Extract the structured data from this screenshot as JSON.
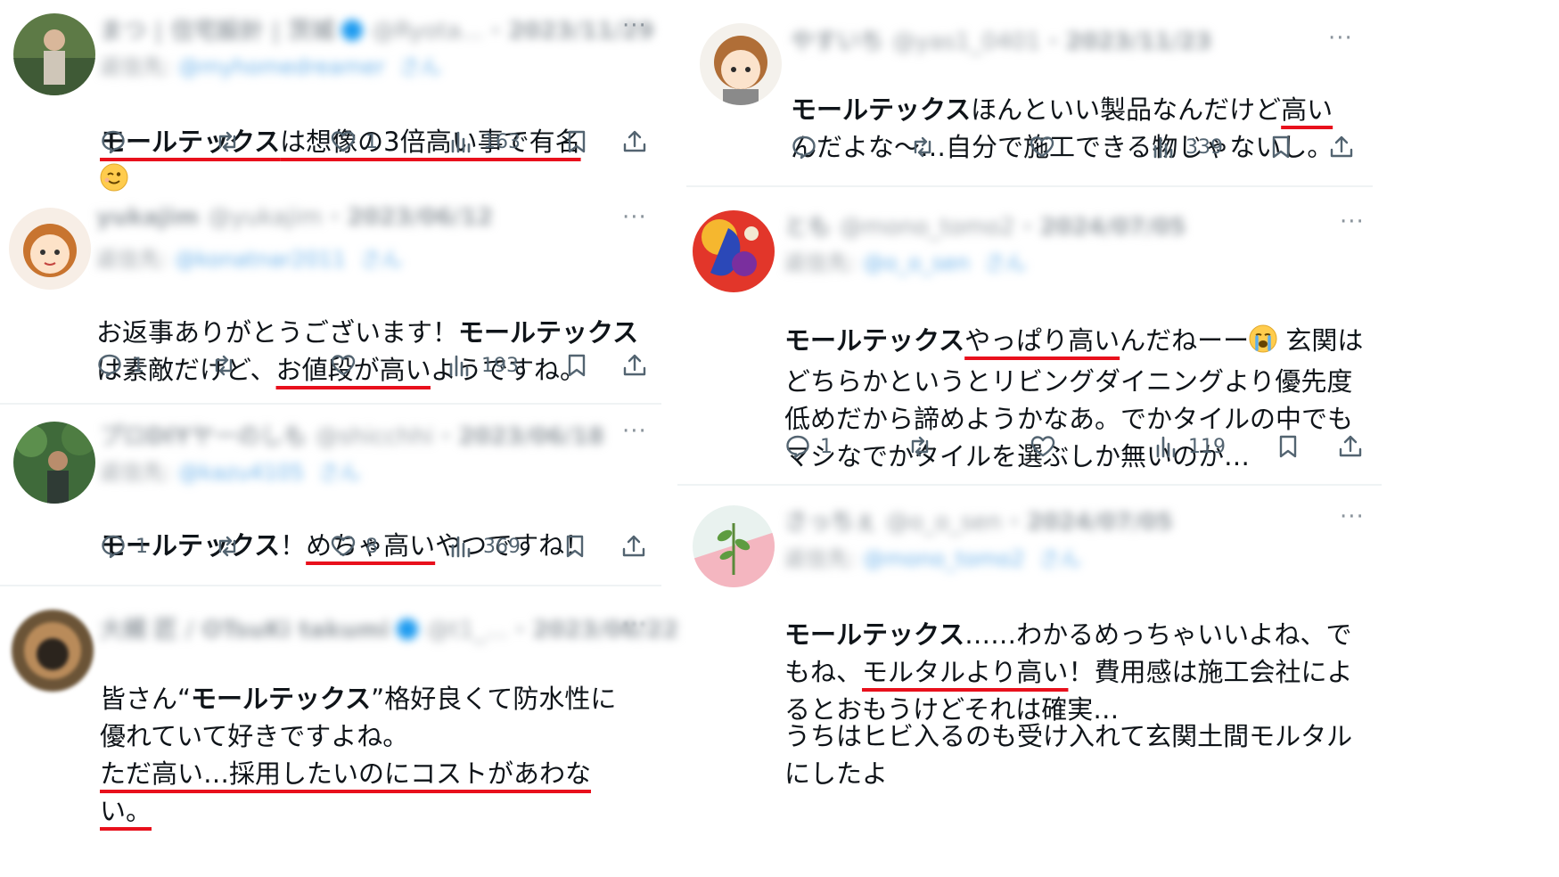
{
  "brand_word": "モールテックス",
  "colors": {
    "underline": "#e8101c",
    "text": "#0f1419",
    "meta": "#536471",
    "verified": "#1d9bf0"
  },
  "tweets": [
    {
      "author": "まつ | 住宅設計 | 茨城",
      "handle": "@Ryota...",
      "date": "2023/11/29",
      "reply_to": "@myhomedreamer",
      "body": {
        "brand": "モールテックス",
        "underlined_after_brand": "は想像の3倍高い事で有名",
        "emoji": "wink-emoji"
      },
      "stats": {
        "replies": "",
        "reposts": "",
        "likes": "1",
        "views": "163"
      }
    },
    {
      "author": "yukajim",
      "handle": "@yukajim",
      "date": "2023/06/12",
      "reply_to": "@konatnar2011",
      "body": {
        "prefix": "お返事ありがとうございます！",
        "brand": "モールテックス",
        "text_after_brand": "は素敵だけど、",
        "underlined": "お値段が高い",
        "suffix": "ようですね。"
      },
      "stats": {
        "replies": "1",
        "reposts": "",
        "likes": "",
        "views": "193"
      }
    },
    {
      "author": "プロDIYヤーのしも",
      "handle": "@shicchhi",
      "date": "2023/06/18",
      "reply_to": "@kazu4105",
      "body": {
        "brand": "モールテックス",
        "text_after_brand": "！",
        "underlined": "めちゃ高い",
        "suffix": "やつですね！"
      },
      "stats": {
        "replies": "1",
        "reposts": "",
        "likes": "8",
        "views": "369"
      }
    },
    {
      "author": "大槻 匠 / OTsuKi takumi",
      "handle": "@t1_...",
      "date": "2023/06/22",
      "body": {
        "prefix": "皆さん“",
        "brand": "モールテックス",
        "text_after_brand": "”格好良くて防水性に優れていて好きですよね。",
        "underlined": "ただ高い…採用したいのにコストがあわない。"
      }
    },
    {
      "author": "やすいち",
      "handle": "@yas1_0401",
      "date": "2023/11/23",
      "body": {
        "brand": "モールテックス",
        "text_after_brand": "ほんといい製品なんだけど",
        "underlined": "高い",
        "suffix": "んだよな〜…自分で施工できる物じゃないし。"
      },
      "stats": {
        "replies": "",
        "reposts": "",
        "likes": "",
        "views": "339"
      }
    },
    {
      "author": "とも",
      "handle": "@mono_tomo2",
      "date": "2024/07/05",
      "reply_to": "@o_o_sen",
      "body": {
        "brand": "モールテックス",
        "underlined": "やっぱり高い",
        "text_after_underline": "んだねーー",
        "emoji": "crying-emoji",
        "suffix": " 玄関はどちらかというとリビングダイニングより優先度低めだから諦めようかなあ。でかタイルの中でもマシなでかタイルを選ぶしか無いのか…"
      },
      "stats": {
        "replies": "1",
        "reposts": "",
        "likes": "",
        "views": "119"
      }
    },
    {
      "author": "さっちぇ",
      "handle": "@o_o_sen",
      "date": "2024/07/05",
      "reply_to": "@mono_tomo2",
      "body": {
        "brand": "モールテックス",
        "text_after_brand": "……わかるめっちゃいいよね、でもね、",
        "underlined": "モルタルより高い",
        "suffix": "！費用感は施工会社によるとおもうけどそれは確実…",
        "paragraph2": "うちはヒビ入るのも受け入れて玄関土間モルタルにしたよ"
      }
    }
  ],
  "labels": {
    "reply_to_prefix": "返信先:",
    "reply_to_suffix": "さん",
    "more": "···",
    "date_sep": "·"
  }
}
